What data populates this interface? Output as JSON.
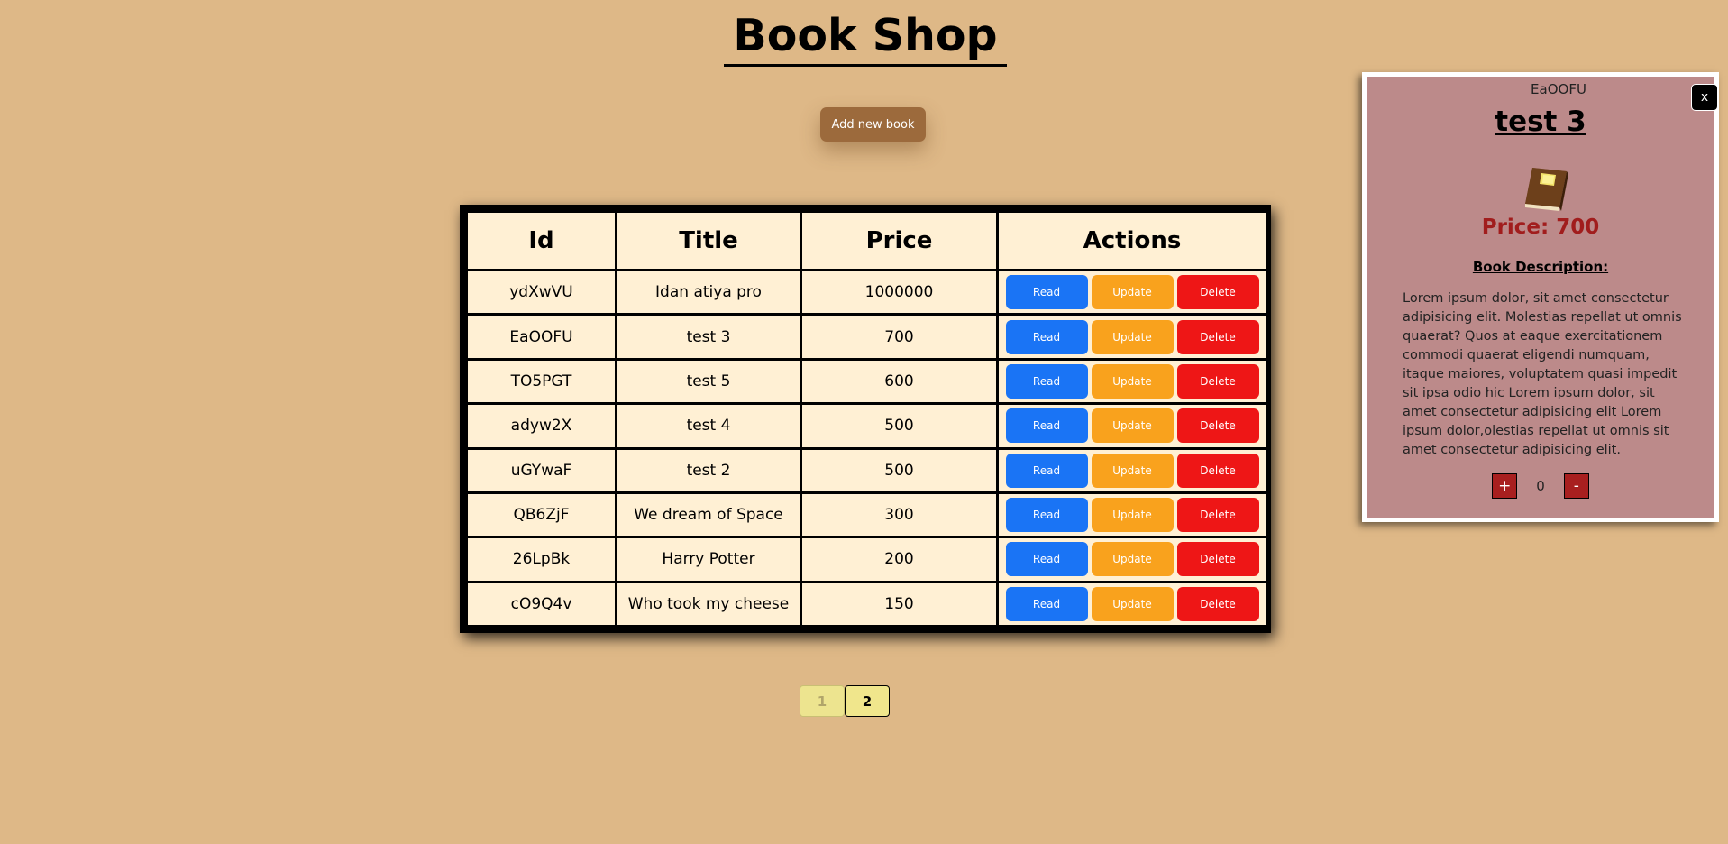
{
  "header": {
    "title": "Book Shop",
    "add_button_label": "Add new book"
  },
  "table": {
    "headers": [
      "Id",
      "Title",
      "Price",
      "Actions"
    ],
    "action_labels": {
      "read": "Read",
      "update": "Update",
      "delete": "Delete"
    },
    "rows": [
      {
        "id": "ydXwVU",
        "title": "Idan atiya pro",
        "price": "1000000"
      },
      {
        "id": "EaOOFU",
        "title": "test 3",
        "price": "700"
      },
      {
        "id": "TO5PGT",
        "title": "test 5",
        "price": "600"
      },
      {
        "id": "adyw2X",
        "title": "test 4",
        "price": "500"
      },
      {
        "id": "uGYwaF",
        "title": "test 2",
        "price": "500"
      },
      {
        "id": "QB6ZjF",
        "title": "We dream of Space",
        "price": "300"
      },
      {
        "id": "26LpBk",
        "title": "Harry Potter",
        "price": "200"
      },
      {
        "id": "cO9Q4v",
        "title": "Who took my cheese",
        "price": "150"
      }
    ]
  },
  "pagination": {
    "pages": [
      {
        "label": "1",
        "state": "disabled"
      },
      {
        "label": "2",
        "state": "active"
      }
    ]
  },
  "detail": {
    "id": "EaOOFU",
    "close_label": "x",
    "title": "test 3",
    "icon": "book-icon",
    "price_text": "Price: 700",
    "description_heading": "Book Description:",
    "description": "Lorem ipsum dolor, sit amet consectetur adipisicing elit. Molestias repellat ut omnis quaerat? Quos at eaque exercitationem commodi quaerat eligendi numquam, itaque maiores, voluptatem quasi impedit sit ipsa odio hic Lorem ipsum dolor, sit amet consectetur adipisicing elit Lorem ipsum dolor,olestias repellat ut omnis sit amet consectetur adipisicing elit.",
    "increment_label": "+",
    "quantity": "0",
    "decrement_label": "-"
  },
  "colors": {
    "page_background": "#deb887",
    "table_background": "#fff0d4",
    "add_button": "#9c6a3c",
    "read_button": "#1a74f5",
    "update_button": "#f9a21d",
    "delete_button": "#ee1616",
    "panel_background": "#bc8a8a",
    "price_text": "#a11d1d",
    "pagination_button": "#f0e68c"
  }
}
